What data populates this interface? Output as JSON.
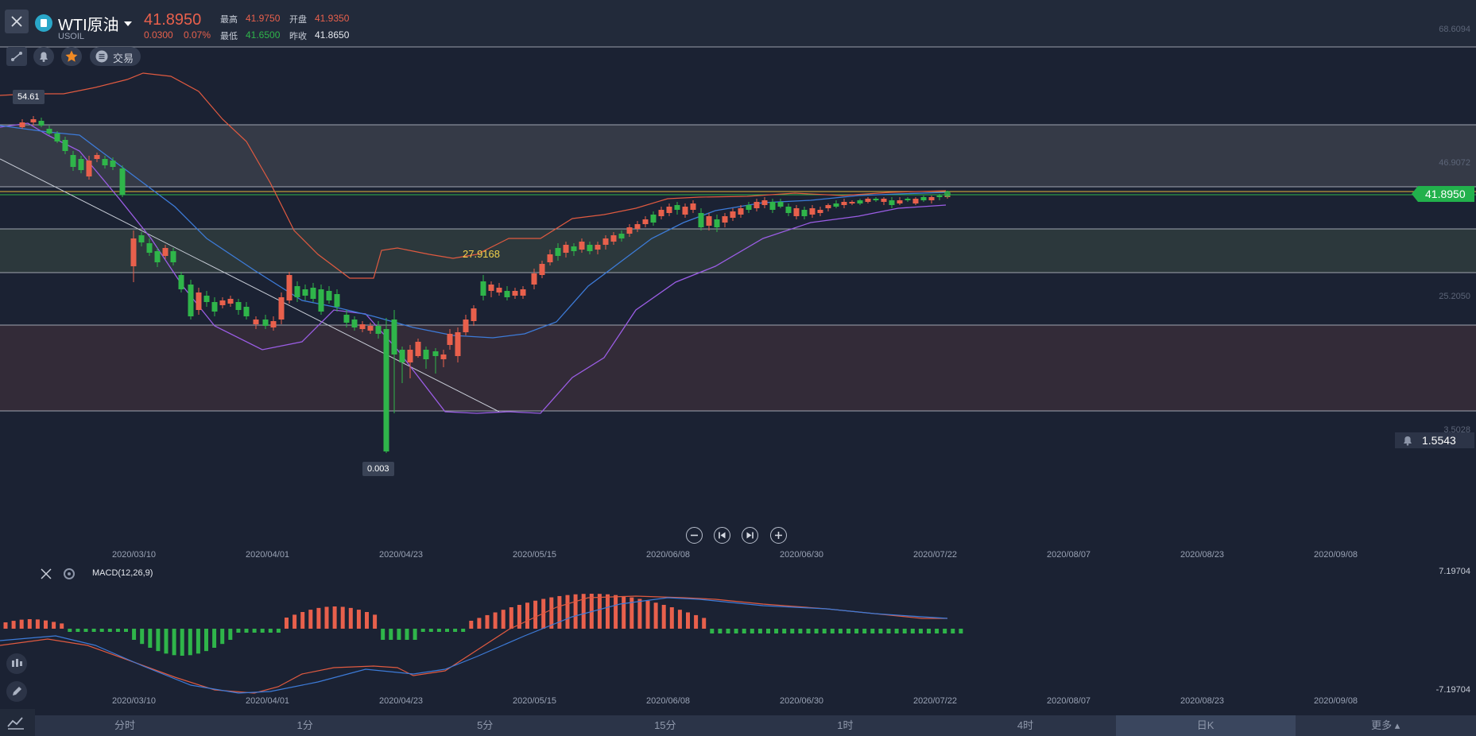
{
  "header": {
    "name": "WTI原油",
    "code": "USOIL",
    "price": "41.8950",
    "change": "0.0300",
    "change_pct": "0.07%",
    "high_label": "最高",
    "high": "41.9750",
    "open_label": "开盘",
    "open": "41.9350",
    "low_label": "最低",
    "low": "41.6500",
    "prev_label": "昨收",
    "prev": "41.8650"
  },
  "toolbar": {
    "trade_label": "交易"
  },
  "chart": {
    "price_axis": [
      "68.6094",
      "46.9072",
      "25.2050",
      "3.5028"
    ],
    "current_price": "41.8950",
    "alert_price": "1.5543",
    "max_marker": "54.61",
    "min_marker": "0.003",
    "highlight_value": "27.9168",
    "dates": [
      "2020/03/10",
      "2020/04/01",
      "2020/04/23",
      "2020/05/15",
      "2020/06/08",
      "2020/06/30",
      "2020/07/22",
      "2020/08/07",
      "2020/08/23",
      "2020/09/08"
    ]
  },
  "macd": {
    "title": "MACD(12,26,9)",
    "axis_top": "7.19704",
    "axis_bottom": "-7.19704"
  },
  "timeframes": [
    "分时",
    "1分",
    "5分",
    "15分",
    "1时",
    "4时",
    "日K",
    "更多"
  ],
  "active_timeframe": "日K",
  "colors": {
    "up": "#e8604c",
    "down": "#2fb54a",
    "accent": "#22b14c",
    "background": "#1b2233"
  }
}
